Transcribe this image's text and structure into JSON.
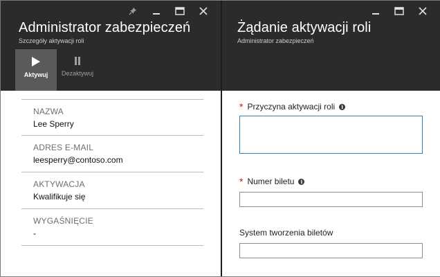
{
  "left_blade": {
    "title": "Administrator zabezpieczeń",
    "subtitle": "Szczegóły aktywacji roli",
    "window_controls": [
      "pin-icon",
      "minimize-icon",
      "maximize-icon",
      "close-icon"
    ],
    "commands": [
      {
        "label": "Aktywuj",
        "icon": "play-icon",
        "state": "active"
      },
      {
        "label": "Dezaktywuj",
        "icon": "pause-icon",
        "state": "disabled"
      }
    ],
    "fields": [
      {
        "label": "NAZWA",
        "value": "Lee Sperry"
      },
      {
        "label": "ADRES E-MAIL",
        "value": "leesperry@contoso.com"
      },
      {
        "label": "AKTYWACJA",
        "value": "Kwalifikuje się"
      },
      {
        "label": "WYGAŚNIĘCIE",
        "value": "-"
      }
    ]
  },
  "right_blade": {
    "title": "Żądanie aktywacji roli",
    "subtitle": "Administrator zabezpieczeń",
    "window_controls": [
      "minimize-icon",
      "maximize-icon",
      "close-icon"
    ],
    "form": {
      "reason_label": "Przyczyna aktywacji roli",
      "reason_value": "",
      "ticket_number_label": "Numer biletu",
      "ticket_number_value": "",
      "ticketing_system_label": "System tworzenia biletów",
      "ticketing_system_value": "",
      "required_marker": "*",
      "info_glyph": "i"
    }
  },
  "colors": {
    "header_bg": "#2b2b2b",
    "active_command_bg": "#5a5a5a",
    "focus_border": "#2a82c6",
    "required": "#c71a1a"
  }
}
